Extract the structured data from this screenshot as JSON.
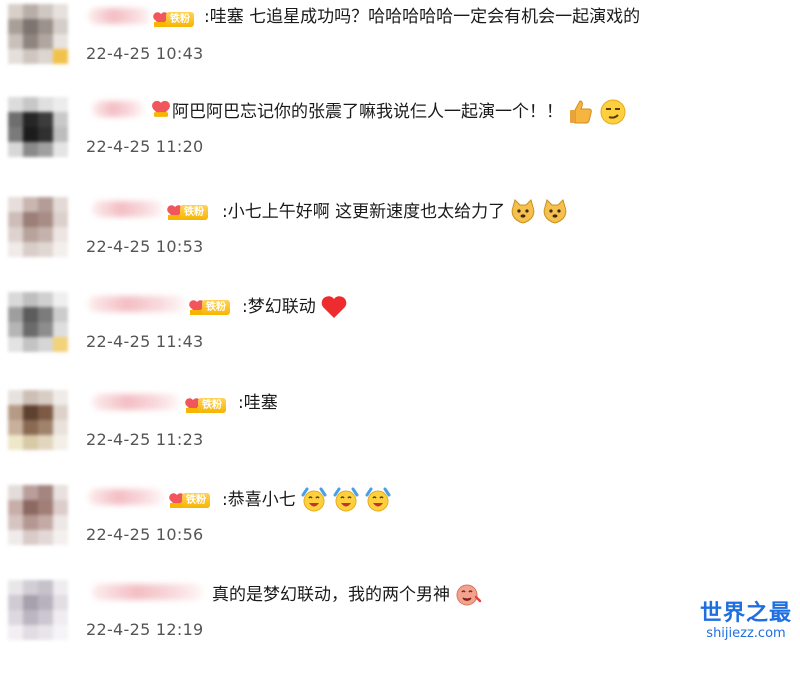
{
  "comments": [
    {
      "badge": "铁粉",
      "text": ":哇塞 七追星成功吗？哈哈哈哈哈一定会有机会一起演戏的",
      "emojis": [],
      "time": "22-4-25 10:43"
    },
    {
      "badge": "",
      "text": "阿巴阿巴忘记你的张震了嘛我说仨人一起演一个！！",
      "emojis": [
        "thumbs-up-emoji",
        "smirk-emoji"
      ],
      "time": "22-4-25 11:20"
    },
    {
      "badge": "铁粉",
      "text": ":小七上午好啊 这更新速度也太给力了",
      "emojis": [
        "doge-emoji",
        "doge-emoji"
      ],
      "time": "22-4-25 10:53"
    },
    {
      "badge": "铁粉",
      "text": ":梦幻联动",
      "emojis": [
        "red-heart-emoji"
      ],
      "time": "22-4-25 11:43"
    },
    {
      "badge": "铁粉",
      "text": ":哇塞",
      "emojis": [],
      "time": "22-4-25 11:23"
    },
    {
      "badge": "铁粉",
      "text": ":恭喜小七",
      "emojis": [
        "cheering-emoji",
        "cheering-emoji",
        "cheering-emoji"
      ],
      "time": "22-4-25 10:56"
    },
    {
      "badge": "",
      "text": "真的是梦幻联动，我的两个男神",
      "emojis": [
        "drooling-emoji"
      ],
      "time": "22-4-25 12:19"
    }
  ],
  "watermark": {
    "title": "世界之最",
    "url": "shijiezz.com"
  },
  "colors": {
    "badge": "#f7b500",
    "name_blur": "#eea8af",
    "timestamp": "#555555",
    "watermark": "#1f6fe0"
  }
}
